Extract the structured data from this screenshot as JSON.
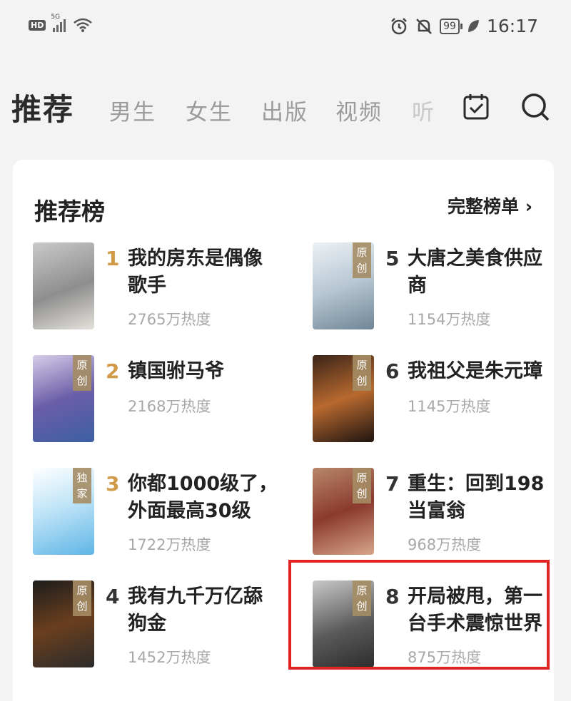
{
  "status_bar": {
    "hd": "HD",
    "signal": "5G",
    "battery": "99",
    "time": "16:17"
  },
  "nav": {
    "active_tab": "推荐",
    "tabs": [
      "男生",
      "女生",
      "出版",
      "视频",
      "听"
    ]
  },
  "ranking": {
    "title": "推荐榜",
    "more": "完整榜单 ›",
    "books": [
      {
        "rank": "1",
        "title": "我的房东是偶像\n歌手",
        "heat": "2765万热度",
        "tag": "",
        "cover_colors": [
          "#9a9a9a",
          "#d9d6d0"
        ]
      },
      {
        "rank": "2",
        "title": "镇国驸马爷",
        "heat": "2168万热度",
        "tag": "原创",
        "cover_colors": [
          "#6b5ea8",
          "#b9a8d8"
        ]
      },
      {
        "rank": "3",
        "title": "你都1000级了，\n外面最高30级",
        "heat": "1722万热度",
        "tag": "独家",
        "cover_colors": [
          "#7fc8ef",
          "#e9f4fb"
        ]
      },
      {
        "rank": "4",
        "title": "我有九千万亿舔\n狗金",
        "heat": "1452万热度",
        "tag": "原创",
        "cover_colors": [
          "#2a2a2a",
          "#7a5a3a"
        ]
      },
      {
        "rank": "5",
        "title": "大唐之美食供应\n商",
        "heat": "1154万热度",
        "tag": "原创",
        "cover_colors": [
          "#b7c7d3",
          "#eef2f5"
        ]
      },
      {
        "rank": "6",
        "title": "我祖父是朱元璋",
        "heat": "1145万热度",
        "tag": "原创",
        "cover_colors": [
          "#3a2418",
          "#b8692f"
        ]
      },
      {
        "rank": "7",
        "title": "重生：回到198\n当富翁",
        "heat": "968万热度",
        "tag": "原创",
        "cover_colors": [
          "#8b3a2e",
          "#d7a58a"
        ]
      },
      {
        "rank": "8",
        "title": "开局被甩，第一\n台手术震惊世界",
        "heat": "875万热度",
        "tag": "原创",
        "cover_colors": [
          "#5a5a5a",
          "#c9c9c9"
        ]
      }
    ]
  },
  "colors": {
    "accent_rank": "#d19a47",
    "highlight_box": "#e32323"
  }
}
